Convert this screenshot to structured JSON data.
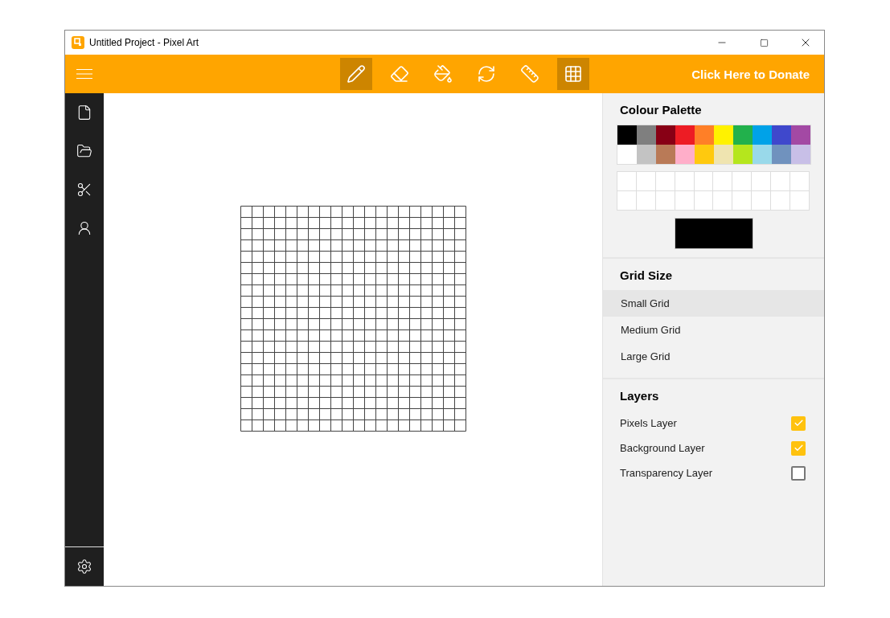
{
  "window": {
    "title": "Untitled Project - Pixel Art"
  },
  "toolbar": {
    "tools": [
      {
        "kind": "pencil",
        "selected": true
      },
      {
        "kind": "eraser",
        "selected": false
      },
      {
        "kind": "fill",
        "selected": false
      },
      {
        "kind": "rotate",
        "selected": false
      },
      {
        "kind": "ruler",
        "selected": false
      },
      {
        "kind": "grid",
        "selected": true
      }
    ],
    "donate": "Click Here to Donate"
  },
  "sidebar": {
    "items": [
      {
        "kind": "new"
      },
      {
        "kind": "open"
      },
      {
        "kind": "export"
      },
      {
        "kind": "account"
      }
    ]
  },
  "palette": {
    "title": "Colour Palette",
    "colors": [
      {
        "color": "#000000"
      },
      {
        "color": "#7f7f7f"
      },
      {
        "color": "#880015"
      },
      {
        "color": "#ed1c24"
      },
      {
        "color": "#ff7f27"
      },
      {
        "color": "#fff200"
      },
      {
        "color": "#22b14c"
      },
      {
        "color": "#00a2e8"
      },
      {
        "color": "#3f48cc"
      },
      {
        "color": "#a349a4"
      },
      {
        "color": "#ffffff"
      },
      {
        "color": "#c3c3c3"
      },
      {
        "color": "#b97a57"
      },
      {
        "color": "#ffaec9"
      },
      {
        "color": "#ffc90e"
      },
      {
        "color": "#efe4b0"
      },
      {
        "color": "#b5e61d"
      },
      {
        "color": "#99d9ea"
      },
      {
        "color": "#7092be"
      },
      {
        "color": "#c8bfe7"
      }
    ],
    "current": {
      "color": "#000000"
    }
  },
  "grid_size": {
    "title": "Grid Size",
    "options": [
      {
        "label": "Small Grid",
        "selected": true
      },
      {
        "label": "Medium Grid",
        "selected": false
      },
      {
        "label": "Large Grid",
        "selected": false
      }
    ]
  },
  "layers": {
    "title": "Layers",
    "items": [
      {
        "label": "Pixels Layer",
        "checked": true
      },
      {
        "label": "Background Layer",
        "checked": true
      },
      {
        "label": "Transparency Layer",
        "checked": false
      }
    ]
  }
}
